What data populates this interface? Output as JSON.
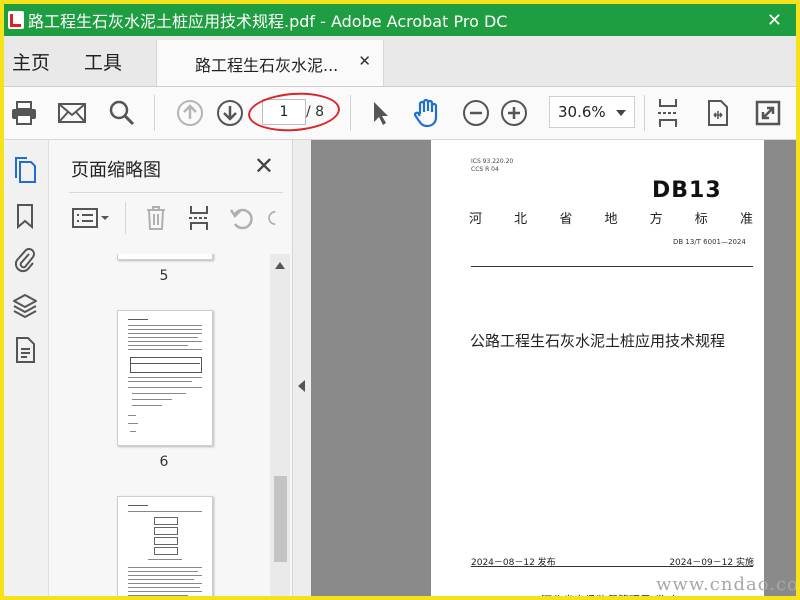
{
  "window": {
    "title": "路工程生石灰水泥土桩应用技术规程.pdf - Adobe Acrobat Pro DC",
    "close_glyph": "✕"
  },
  "menu": {
    "home": "主页",
    "tools": "工具"
  },
  "tab": {
    "label": "路工程生石灰水泥...",
    "close_glyph": "✕"
  },
  "toolbar": {
    "current_page": "1",
    "total_pages": "/ 8",
    "zoom": "30.6%"
  },
  "panel": {
    "title": "页面缩略图",
    "close_glyph": "✕",
    "thumbnails": [
      {
        "label": "5"
      },
      {
        "label": "6"
      },
      {
        "label": ""
      }
    ]
  },
  "document": {
    "ics": "ICS  93.220.20",
    "ccs": "CCS  R 04",
    "standard_code": "DB13",
    "province": [
      "河",
      "北",
      "省",
      "地",
      "方",
      "标",
      "准"
    ],
    "standard_no": "DB 13/T 6001—2024",
    "title": "公路工程生石灰水泥土桩应用技术规程",
    "publish_date": "2024－08－12 发布",
    "implement_date": "2024－09－12 实施",
    "issuer": "河北省市场监督管理局  发 布"
  },
  "watermark": "www.cndao.co",
  "colors": {
    "titlebar": "#1f9d41",
    "frame": "#f5e21a",
    "annotation_circle": "#d9262a",
    "hand_tool_active": "#1f6fd0",
    "nav_active": "#1f6fd0"
  }
}
